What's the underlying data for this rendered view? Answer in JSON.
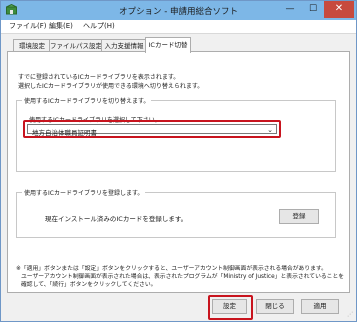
{
  "window": {
    "title": "オプション - 申請用総合ソフト",
    "min_glyph": "—",
    "max_glyph": "☐",
    "close_glyph": "✕"
  },
  "menu": {
    "items": [
      {
        "label": "ファイル(F)"
      },
      {
        "label": "編集(E)"
      },
      {
        "label": "ヘルプ(H)"
      }
    ]
  },
  "tabs": [
    {
      "label": "環境設定",
      "active": false
    },
    {
      "label": "ファイルパス設定",
      "active": false
    },
    {
      "label": "入力支援情報",
      "active": false
    },
    {
      "label": "ICカード切替",
      "active": true
    }
  ],
  "ic_tab": {
    "desc_line1": "すでに登録されているICカードライブラリを表示されます。",
    "desc_line2": "選択したICカードライブラリが使用できる環境へ切り替えられます。",
    "switch_group_label": "使用するICカードライブラリを切り替えます。",
    "combo_label": "使用するICカードライブラリを選択して下さい。",
    "combo_value": "地方自治体職員証明書",
    "register_group_label": "使用するICカードライブラリを登録します。",
    "register_text": "現在インストール済みのICカードを登録します。",
    "register_button": "登録",
    "note_line1": "※「適用」ボタンまたは「設定」ボタンをクリックすると、ユーザーアカウント制御画面が表示される場合があります。",
    "note_line2": "ユーザーアカウント制御画面が表示された場合は、表示されたプログラムが「Ministry of Justice」と表示されていることを",
    "note_line3": "確認して、「続行」ボタンをクリックしてください。"
  },
  "footer": {
    "ok_label": "設定",
    "close_label": "閉じる",
    "apply_label": "適用"
  },
  "colors": {
    "titlebar": "#7db7e7",
    "highlight": "#c8141e",
    "close": "#c74a3e"
  }
}
